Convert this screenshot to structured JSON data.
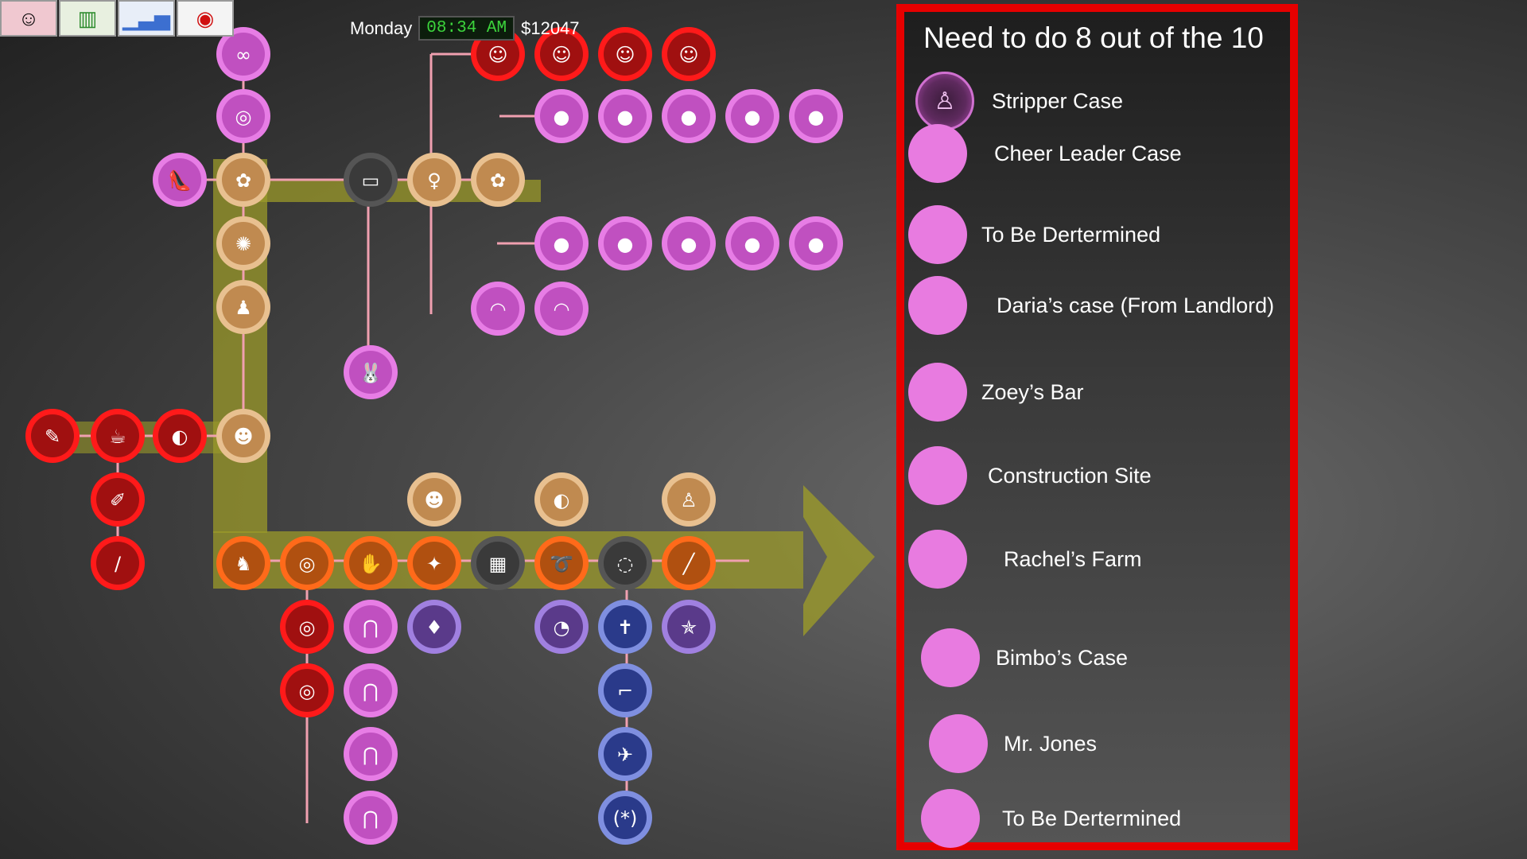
{
  "toolbar": {
    "buttons": [
      {
        "name": "character-portrait",
        "icon": "girl-portrait-icon"
      },
      {
        "name": "map",
        "icon": "map-icon"
      },
      {
        "name": "stats",
        "icon": "bar-chart-icon"
      },
      {
        "name": "hide-ui",
        "icon": "eye-crossed-icon"
      }
    ]
  },
  "hud": {
    "day": "Monday",
    "time": "08:34 AM",
    "money": "$12047"
  },
  "panel": {
    "title": "Need to do 8 out of the 10",
    "items": [
      {
        "label": "Stripper Case",
        "completed": true
      },
      {
        "label": "Cheer Leader Case",
        "completed": false
      },
      {
        "label": "To Be Dertermined",
        "completed": false
      },
      {
        "label": "Daria’s case (From Landlord)",
        "completed": false
      },
      {
        "label": "Zoey’s Bar",
        "completed": false
      },
      {
        "label": "Construction Site",
        "completed": false
      },
      {
        "label": "Rachel’s Farm",
        "completed": false
      },
      {
        "label": "Bimbo’s Case",
        "completed": false
      },
      {
        "label": "Mr. Jones",
        "completed": false
      },
      {
        "label": "To Be Dertermined",
        "completed": false
      }
    ]
  },
  "colors": {
    "panel_border": "#e60000",
    "case_dot": "#e87be0",
    "path_highlight": "#9b9a2a",
    "node_ring_pink": "#e77de5",
    "node_ring_red": "#ff1a1a",
    "node_ring_orange": "#ff6a1a",
    "node_ring_tan": "#e8c090",
    "node_ring_blue": "#7f8fe0",
    "node_ring_purple": "#a080e0"
  }
}
